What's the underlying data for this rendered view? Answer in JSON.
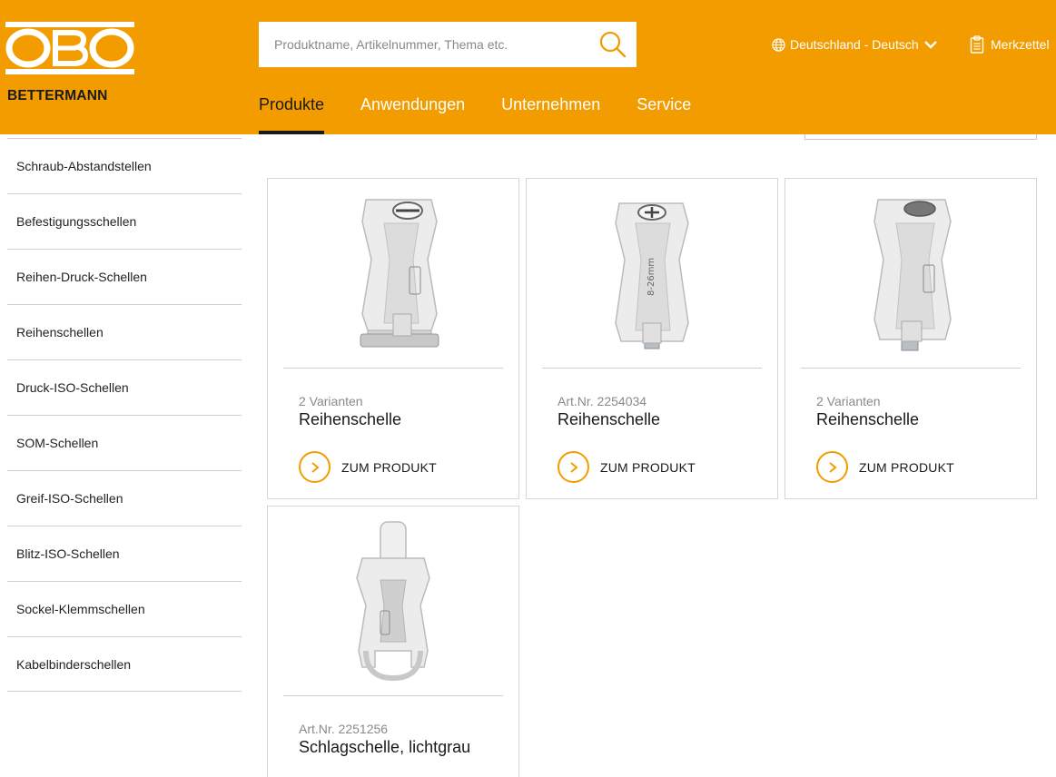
{
  "brand": {
    "logo_text": "OBO",
    "logo_sub": "BETTERMANN"
  },
  "search": {
    "placeholder": "Produktname, Artikelnummer, Thema etc."
  },
  "header": {
    "country_label": "Deutschland - Deutsch",
    "merkzettel_label": "Merkzettel"
  },
  "nav": {
    "items": [
      "Produkte",
      "Anwendungen",
      "Unternehmen",
      "Service"
    ],
    "active": "Produkte"
  },
  "sidebar": {
    "items": [
      "Schraub-Abstandstellen",
      "Befestigungsschellen",
      "Reihen-Druck-Schellen",
      "Reihenschellen",
      "Druck-ISO-Schellen",
      "SOM-Schellen",
      "Greif-ISO-Schellen",
      "Blitz-ISO-Schellen",
      "Sockel-Klemmschellen",
      "Kabelbinderschellen"
    ]
  },
  "products": [
    {
      "meta": "2 Varianten",
      "title": "Reihenschelle",
      "cta": "ZUM PRODUKT"
    },
    {
      "meta": "Art.Nr. 2254034",
      "title": "Reihenschelle",
      "cta": "ZUM PRODUKT",
      "clip_marking": "8-26mm"
    },
    {
      "meta": "2 Varianten",
      "title": "Reihenschelle",
      "cta": "ZUM PRODUKT"
    },
    {
      "meta": "Art.Nr. 2251256",
      "title": "Schlagschelle, lichtgrau"
    }
  ],
  "colors": {
    "brand_orange": "#f39c00",
    "text_dark": "#1a1a1a",
    "muted": "#8a8a8a"
  },
  "icons": {
    "search": "search-icon",
    "globe": "globe-icon",
    "chevron": "chevron-down-icon",
    "clipboard": "clipboard-icon",
    "arrow": "chevron-right-icon"
  }
}
